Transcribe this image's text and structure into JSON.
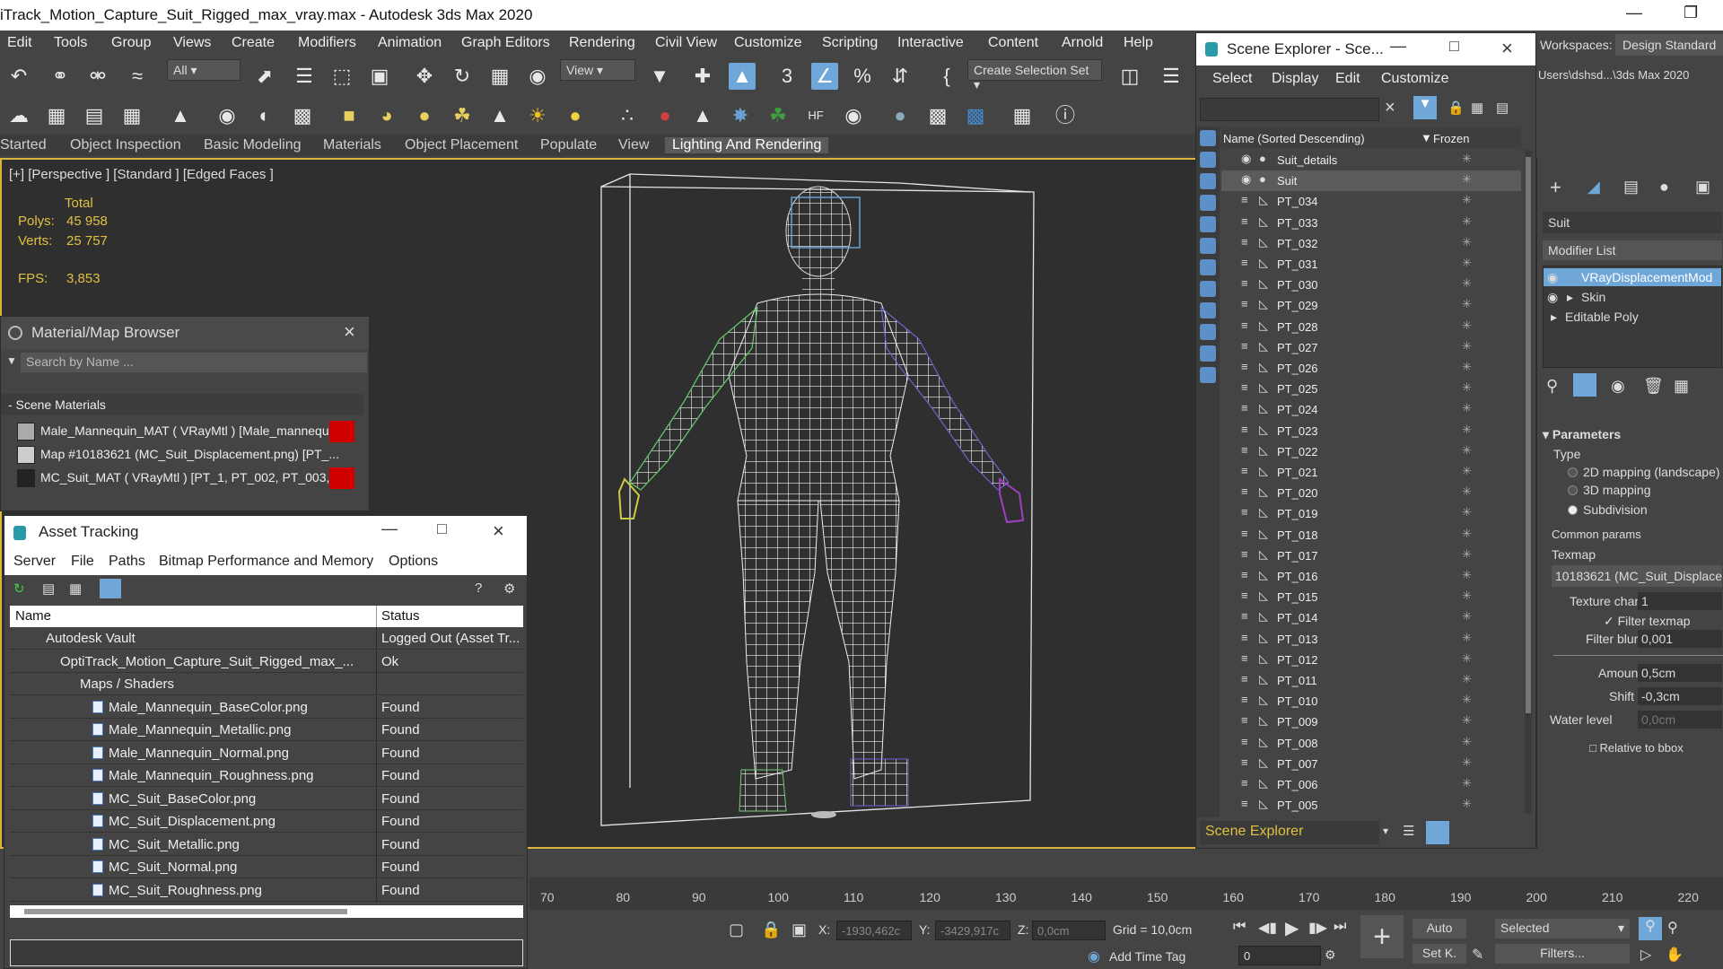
{
  "app": {
    "title": "iTrack_Motion_Capture_Suit_Rigged_max_vray.max - Autodesk 3ds Max 2020",
    "workspaces_label": "Workspaces:",
    "workspace_value": "Design Standard",
    "user_path": "Users\\dshsd...\\3ds Max 2020"
  },
  "menu": [
    "Edit",
    "Tools",
    "Group",
    "Views",
    "Create",
    "Modifiers",
    "Animation",
    "Graph Editors",
    "Rendering",
    "Civil View",
    "Customize",
    "Scripting",
    "Interactive",
    "Content",
    "Arnold",
    "Help"
  ],
  "toolbar": {
    "selection_filter": "All",
    "ref_coord": "View",
    "selection_set": "Create Selection Set"
  },
  "ribbon_tabs": [
    "Started",
    "Object Inspection",
    "Basic Modeling",
    "Materials",
    "Object Placement",
    "Populate",
    "View",
    "Lighting And Rendering"
  ],
  "viewport": {
    "label": "[+] [Perspective ] [Standard ] [Edged Faces ]",
    "stats_total": "Total",
    "polys_label": "Polys:",
    "polys_value": "45 958",
    "verts_label": "Verts:",
    "verts_value": "25 757",
    "fps_label": "FPS:",
    "fps_value": "3,853"
  },
  "material_browser": {
    "title": "Material/Map Browser",
    "search_placeholder": "Search by Name ...",
    "section": "- Scene Materials",
    "items": [
      "Male_Mannequin_MAT  ( VRayMtl )  [Male_mannequ...",
      "Map #10183621 (MC_Suit_Displacement.png)  [PT_...",
      "MC_Suit_MAT  ( VRayMtl )  [PT_1, PT_002, PT_003,..."
    ]
  },
  "asset_tracking": {
    "title": "Asset Tracking",
    "menu": [
      "Server",
      "File",
      "Paths",
      "Bitmap Performance and Memory",
      "Options"
    ],
    "col_name": "Name",
    "col_status": "Status",
    "rows": [
      {
        "name": "Autodesk Vault",
        "status": "Logged Out (Asset Tr..."
      },
      {
        "name": "OptiTrack_Motion_Capture_Suit_Rigged_max_...",
        "status": "Ok"
      },
      {
        "name": "Maps / Shaders",
        "status": ""
      },
      {
        "name": "Male_Mannequin_BaseColor.png",
        "status": "Found"
      },
      {
        "name": "Male_Mannequin_Metallic.png",
        "status": "Found"
      },
      {
        "name": "Male_Mannequin_Normal.png",
        "status": "Found"
      },
      {
        "name": "Male_Mannequin_Roughness.png",
        "status": "Found"
      },
      {
        "name": "MC_Suit_BaseColor.png",
        "status": "Found"
      },
      {
        "name": "MC_Suit_Displacement.png",
        "status": "Found"
      },
      {
        "name": "MC_Suit_Metallic.png",
        "status": "Found"
      },
      {
        "name": "MC_Suit_Normal.png",
        "status": "Found"
      },
      {
        "name": "MC_Suit_Roughness.png",
        "status": "Found"
      }
    ]
  },
  "scene_explorer": {
    "title": "Scene Explorer - Sce...",
    "menu": [
      "Select",
      "Display",
      "Edit",
      "Customize"
    ],
    "col_name": "Name (Sorted Descending)",
    "col_frozen": "Frozen",
    "rows": [
      "Suit_details",
      "Suit",
      "PT_034",
      "PT_033",
      "PT_032",
      "PT_031",
      "PT_030",
      "PT_029",
      "PT_028",
      "PT_027",
      "PT_026",
      "PT_025",
      "PT_024",
      "PT_023",
      "PT_022",
      "PT_021",
      "PT_020",
      "PT_019",
      "PT_018",
      "PT_017",
      "PT_016",
      "PT_015",
      "PT_014",
      "PT_013",
      "PT_012",
      "PT_011",
      "PT_010",
      "PT_009",
      "PT_008",
      "PT_007",
      "PT_006",
      "PT_005"
    ],
    "footer": "Scene Explorer"
  },
  "command_panel": {
    "object_name": "Suit",
    "modifier_list": "Modifier List",
    "stack": [
      "VRayDisplacementMod",
      "Skin",
      "Editable Poly"
    ],
    "parameters": "Parameters",
    "type_label": "Type",
    "type_options": [
      "2D mapping (landscape)",
      "3D mapping",
      "Subdivision"
    ],
    "common_params": "Common params",
    "texmap_label": "Texmap",
    "texmap_value": "10183621 (MC_Suit_Displace",
    "texture_chan_label": "Texture chan",
    "texture_chan_value": "1",
    "filter_texmap": "Filter texmap",
    "filter_blur_label": "Filter blur",
    "filter_blur_value": "0,001",
    "amount_label": "Amount",
    "amount_value": "0,5cm",
    "shift_label": "Shift",
    "shift_value": "-0,3cm",
    "water_level_label": "Water level",
    "water_level_value": "0,0cm",
    "relative_bbox": "Relative to bbox"
  },
  "timeline": {
    "ticks": [
      "70",
      "80",
      "90",
      "100",
      "110",
      "120",
      "130",
      "140",
      "150",
      "160",
      "170",
      "180",
      "190",
      "200",
      "210",
      "220"
    ]
  },
  "statusbar": {
    "x_label": "X:",
    "x_value": "-1930,462c",
    "y_label": "Y:",
    "y_value": "-3429,917c",
    "z_label": "Z:",
    "z_value": "0,0cm",
    "grid": "Grid = 10,0cm",
    "add_time_tag": "Add Time Tag",
    "frame": "0",
    "auto": "Auto",
    "set_key": "Set K.",
    "selected": "Selected",
    "filters": "Filters..."
  }
}
